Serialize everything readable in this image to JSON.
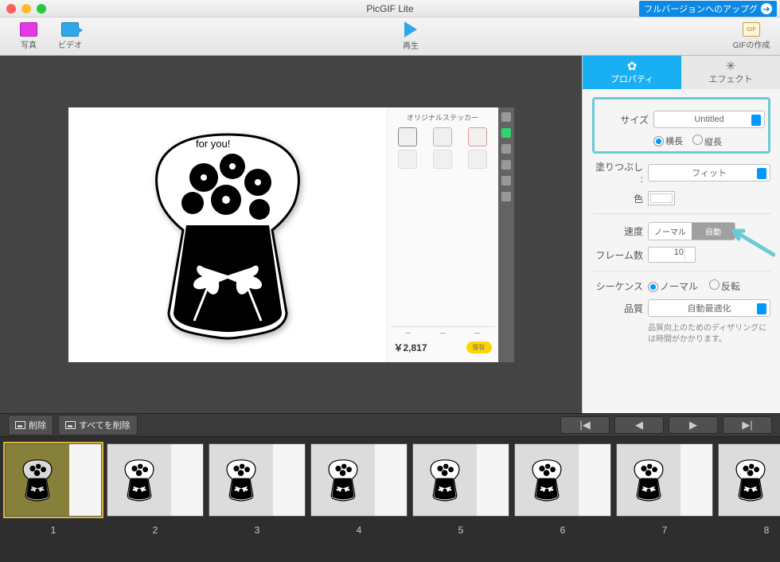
{
  "app": {
    "title": "PicGIF Lite",
    "upgrade": "フルバージョンへのアップグ"
  },
  "toolbar": {
    "photo": "写真",
    "video": "ビデオ",
    "play": "再生",
    "gif": "GIFの作成",
    "gif_badge": "GIF"
  },
  "canvas": {
    "sticker_header": "オリジナルステッカー",
    "price": "￥2,817",
    "save": "保存"
  },
  "props": {
    "tab_properties": "プロパティ",
    "tab_effects": "エフェクト",
    "size_label": "サイズ",
    "size_value": "Untitled",
    "orient_h": "横長",
    "orient_v": "縦長",
    "fill_label": "塗りつぶし :",
    "fill_value": "フィット",
    "color_label": "色",
    "speed_label": "速度",
    "speed_normal": "ノーマル",
    "speed_auto": "自動",
    "frames_label": "フレーム数",
    "frames_value": "10",
    "sequence_label": "シーケンス",
    "seq_normal": "ノーマル",
    "seq_reverse": "反転",
    "quality_label": "品質",
    "quality_value": "自動最適化",
    "quality_hint": "品質向上のためのディザリングには時間がかかります。"
  },
  "tlbar": {
    "delete": "削除",
    "delete_all": "すべてを削除"
  },
  "frames": [
    "1",
    "2",
    "3",
    "4",
    "5",
    "6",
    "7",
    "8"
  ]
}
